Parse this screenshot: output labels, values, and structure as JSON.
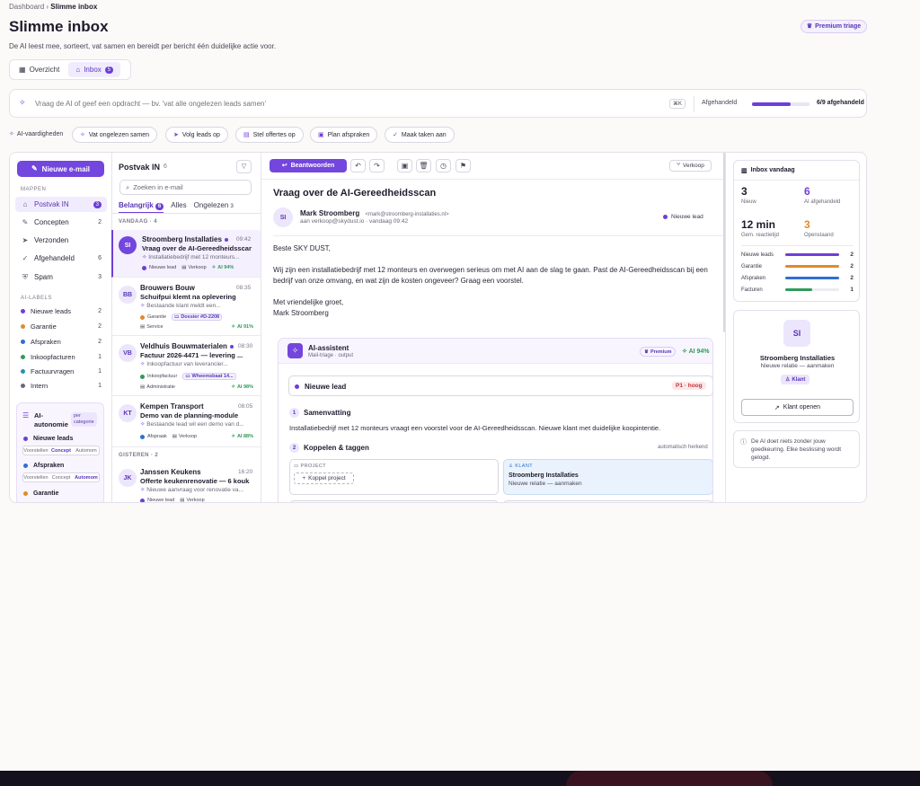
{
  "breadcrumb": {
    "parent": "Dashboard",
    "current": "Slimme inbox"
  },
  "header": {
    "title": "Slimme inbox",
    "subtitle": "De AI leest mee, sorteert, vat samen en bereidt per bericht één duidelijke actie voor.",
    "premium_label": "Premium triage"
  },
  "view_tabs": [
    {
      "label": "Overzicht"
    },
    {
      "label": "Inbox",
      "count": "5"
    }
  ],
  "command": {
    "placeholder": "Vraag de AI of geef een opdracht — bv. 'vat alle ongelezen leads samen'",
    "shortcut": "⌘K",
    "progress_label": "Afgehandeld",
    "progress_value": "6/9 afgehandeld",
    "progress_fraction": 0.667
  },
  "skills": {
    "label": "AI-vaardigheden",
    "items": [
      "Vat ongelezen samen",
      "Volg leads op",
      "Stel offertes op",
      "Plan afspraken",
      "Maak taken aan"
    ]
  },
  "sidebar": {
    "new_mail": "Nieuwe e-mail",
    "folders_label": "MAPPEN",
    "folders": [
      {
        "label": "Postvak IN",
        "count": "3"
      },
      {
        "label": "Concepten",
        "count": "2"
      },
      {
        "label": "Verzonden",
        "count": ""
      },
      {
        "label": "Afgehandeld",
        "count": "6"
      },
      {
        "label": "Spam",
        "count": "3"
      }
    ],
    "labels_label": "AI-LABELS",
    "labels": [
      {
        "label": "Nieuwe leads",
        "count": "2",
        "color": "#6d3fd6"
      },
      {
        "label": "Garantie",
        "count": "2",
        "color": "#e08a2c"
      },
      {
        "label": "Afspraken",
        "count": "2",
        "color": "#2f6fd1"
      },
      {
        "label": "Inkoopfacturen",
        "count": "1",
        "color": "#2f9a5a"
      },
      {
        "label": "Factuurvragen",
        "count": "1",
        "color": "#2a8fb0"
      },
      {
        "label": "Intern",
        "count": "1",
        "color": "#6b6778"
      }
    ],
    "autonomy": {
      "title_1": "AI-",
      "title_2": "autonomie",
      "tag_1": "per",
      "tag_2": "categorie",
      "rows": [
        {
          "label": "Nieuwe leads",
          "color": "#6d3fd6"
        },
        {
          "label": "Afspraken",
          "color": "#2f6fd1"
        },
        {
          "label": "Garantie",
          "color": "#e08a2c"
        }
      ],
      "options": [
        "Voorstellen",
        "Concept",
        "Automom"
      ]
    }
  },
  "list": {
    "title": "Postvak IN",
    "count": "6",
    "search_placeholder": "Zoeken in e-mail",
    "tabs": [
      {
        "label": "Belangrijk",
        "count": "6"
      },
      {
        "label": "Alles",
        "count": ""
      },
      {
        "label": "Ongelezen",
        "count": "3"
      }
    ],
    "group_today": "VANDAAG",
    "group_today_count": "4",
    "group_yesterday": "GISTEREN",
    "group_yesterday_count": "2",
    "messages": [
      {
        "initials": "SI",
        "sender": "Stroomberg Installaties",
        "time": "09:42",
        "subject": "Vraag over de AI-Gereedheidsscan",
        "preview": "Installatiebedrijf met 12 monteurs...",
        "tag1": "Nieuwe lead",
        "tag1_color": "#6d3fd6",
        "tag2": "Verkoop",
        "ai": "AI 94%"
      },
      {
        "initials": "BB",
        "sender": "Brouwers Bouw",
        "time": "08:35",
        "subject": "Schuifpui klemt na oplevering",
        "preview": "Bestaande klant meldt een...",
        "tag1": "Garantie",
        "tag1_color": "#e08a2c",
        "tag2": "Dossier #D-2208",
        "tag3": "Service",
        "ai": "AI 91%"
      },
      {
        "initials": "VB",
        "sender": "Veldhuis Bouwmaterialen",
        "time": "08:30",
        "subject": "Factuur 2026-4471 — levering ...",
        "preview": "Inkoopfactuur van leverancier...",
        "tag1": "Inkoopfactuur",
        "tag1_color": "#2f9a5a",
        "tag2": "Wheemsbaat 14...",
        "tag3": "Administratie",
        "ai": "AI 98%"
      },
      {
        "initials": "KT",
        "sender": "Kempen Transport",
        "time": "08:05",
        "subject": "Demo van de planning-module",
        "preview": "Bestaande lead wil een demo van d...",
        "tag1": "Afspraak",
        "tag1_color": "#2f6fd1",
        "tag2": "Verkoop",
        "ai": "AI 88%"
      },
      {
        "initials": "JK",
        "sender": "Janssen Keukens",
        "time": "16:20",
        "subject": "Offerte keukenrenovatie — 6 kouk...",
        "preview": "Nieuwe aanvraag voor renovatie va...",
        "tag1": "Nieuwe lead",
        "tag1_color": "#6d3fd6",
        "tag2": "Verkoop",
        "ai": ""
      }
    ]
  },
  "reader": {
    "reply_label": "Beantwoorden",
    "category_label": "Verkoop",
    "subject": "Vraag over de AI-Gereedheidsscan",
    "from_name": "Mark Stroomberg",
    "from_email": "<mark@stroomberg-installaties.nl>",
    "to_line": "aan verkoop@skydust.io · vandaag 09:42",
    "lead_label": "Nieuwe lead",
    "greeting": "Beste SKY DUST,",
    "body": "Wij zijn een installatiebedrijf met 12 monteurs en overwegen serieus om met AI aan de slag te gaan. Past de AI-Gereedheidsscan bij een bedrijf van onze omvang, en wat zijn de kosten ongeveer? Graag een voorstel.",
    "closing": "Met vriendelijke groet,",
    "signature": "Mark Stroomberg"
  },
  "assistant": {
    "title": "AI-assistent",
    "subtitle": "Mail-triage · output",
    "premium": "Premium",
    "score": "AI 94%",
    "lead": "Nieuwe lead",
    "priority": "P1 · hoog",
    "step1_num": "1",
    "step1_title": "Samenvatting",
    "step1_text": "Installatiebedrijf met 12 monteurs vraagt een voorstel voor de AI-Gereedheidsscan. Nieuwe klant met duidelijke koopintentie.",
    "step2_num": "2",
    "step2_title": "Koppelen & taggen",
    "auto_label": "automatisch herkend",
    "project_label": "PROJECT",
    "project_button": "Koppel project",
    "klant_label": "KLANT",
    "klant_name": "Stroomberg Installaties",
    "klant_status": "Nieuwe relatie — aanmaken"
  },
  "right": {
    "today_title": "Inbox vandaag",
    "stats": [
      {
        "value": "3",
        "label": "Nieuw",
        "color": "#1f1b2d"
      },
      {
        "value": "6",
        "label": "AI afgehandeld",
        "color": "#6d3fd6"
      },
      {
        "value": "12 min",
        "label": "Gem. reactietijd",
        "color": "#1f1b2d"
      },
      {
        "value": "3",
        "label": "Openstaand",
        "color": "#e08a2c"
      }
    ],
    "bars": [
      {
        "label": "Nieuwe leads",
        "value": "2",
        "fraction": 1.0,
        "color": "#6d3fd6"
      },
      {
        "label": "Garantie",
        "value": "2",
        "fraction": 1.0,
        "color": "#e08a2c"
      },
      {
        "label": "Afspraken",
        "value": "2",
        "fraction": 1.0,
        "color": "#2f6fd1"
      },
      {
        "label": "Facturen",
        "value": "1",
        "fraction": 0.5,
        "color": "#2f9a5a"
      }
    ],
    "contact_initials": "SI",
    "contact_name": "Stroomberg Installaties",
    "contact_status": "Nieuwe relatie — aanmaken",
    "contact_badge": "Klant",
    "contact_button": "Klant openen",
    "notice": "De AI doet niets zonder jouw goedkeuring. Elke beslissing wordt gelogd."
  }
}
